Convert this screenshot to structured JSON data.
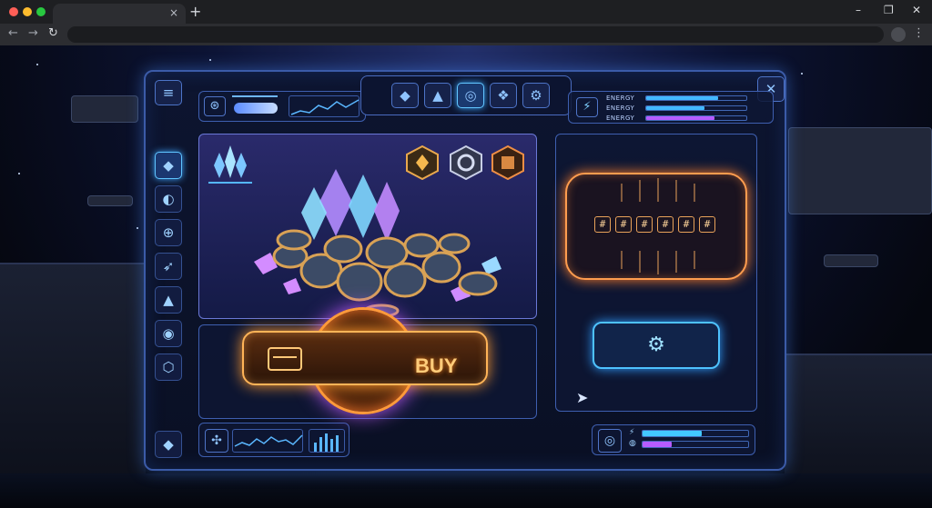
{
  "browser": {
    "tab_close": "×",
    "new_tab": "+",
    "controls": {
      "minimize": "–",
      "restore": "❐",
      "close": "✕"
    },
    "nav": {
      "back": "←",
      "forward": "→",
      "reload": "↻"
    },
    "menu": "⋮"
  },
  "game": {
    "menu_icon": "≡",
    "close_icon": "✕",
    "top_tabs": [
      {
        "name": "tab-crystals",
        "glyph": "◆"
      },
      {
        "name": "tab-rocket",
        "glyph": "▲"
      },
      {
        "name": "tab-globe",
        "glyph": "◎"
      },
      {
        "name": "tab-wings",
        "glyph": "❖"
      },
      {
        "name": "tab-settings",
        "glyph": "⚙"
      }
    ],
    "active_top_tab": 2,
    "stats": [
      {
        "label": "ENERGY",
        "level": 0.72,
        "color": "#43b8ff"
      },
      {
        "label": "ENERGY",
        "level": 0.58,
        "color": "#43b8ff"
      },
      {
        "label": "ENERGY",
        "level": 0.68,
        "color": "#b65cff"
      }
    ],
    "sidebar": [
      {
        "name": "sidebar-crystals",
        "glyph": "◆"
      },
      {
        "name": "sidebar-planet",
        "glyph": "◐"
      },
      {
        "name": "sidebar-globe",
        "glyph": "⊕"
      },
      {
        "name": "sidebar-ship",
        "glyph": "➶"
      },
      {
        "name": "sidebar-rocket",
        "glyph": "▲"
      },
      {
        "name": "sidebar-orbit",
        "glyph": "◉"
      },
      {
        "name": "sidebar-cube",
        "glyph": "⬡"
      }
    ],
    "sidebar_bottom": "◆",
    "code_slots": [
      "#",
      "#",
      "#",
      "#",
      "#",
      "#"
    ],
    "buy_label": "BUY",
    "bottom_stats": [
      {
        "icon": "⚡",
        "level": 0.56,
        "color": "#43c8ff"
      },
      {
        "icon": "◍",
        "level": 0.28,
        "color": "#b65cff"
      }
    ],
    "colors": {
      "accent": "#3b5ba8",
      "orange": "#ffb457",
      "cyan": "#43b8ff",
      "purple": "#b65cff"
    }
  }
}
